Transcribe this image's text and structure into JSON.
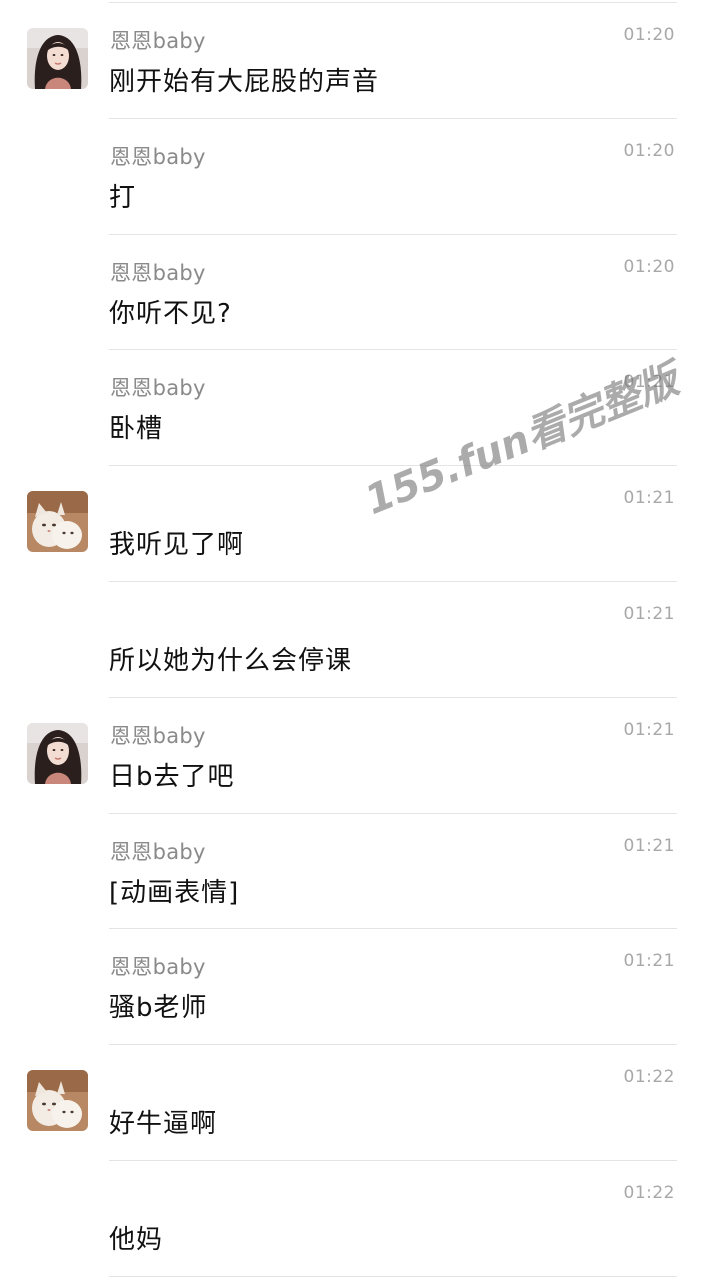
{
  "messages": [
    {
      "avatar": "girl-avatar",
      "sender": "恩恩baby",
      "time": "01:20",
      "text": "刚开始有大屁股的声音"
    },
    {
      "avatar": "",
      "sender": "恩恩baby",
      "time": "01:20",
      "text": "打"
    },
    {
      "avatar": "",
      "sender": "恩恩baby",
      "time": "01:20",
      "text": "你听不见?"
    },
    {
      "avatar": "",
      "sender": "恩恩baby",
      "time": "01:21",
      "text": "卧槽"
    },
    {
      "avatar": "cat-avatar",
      "sender": "",
      "time": "01:21",
      "text": "我听见了啊"
    },
    {
      "avatar": "",
      "sender": "",
      "time": "01:21",
      "text": "所以她为什么会停课"
    },
    {
      "avatar": "girl-avatar",
      "sender": "恩恩baby",
      "time": "01:21",
      "text": "日b去了吧"
    },
    {
      "avatar": "",
      "sender": "恩恩baby",
      "time": "01:21",
      "text": "[动画表情]"
    },
    {
      "avatar": "",
      "sender": "恩恩baby",
      "time": "01:21",
      "text": "骚b老师"
    },
    {
      "avatar": "cat-avatar",
      "sender": "",
      "time": "01:22",
      "text": "好牛逼啊"
    },
    {
      "avatar": "",
      "sender": "",
      "time": "01:22",
      "text": "他妈"
    }
  ],
  "watermark": "155.fun看完整版",
  "colors": {
    "divider": "#e4e4e4",
    "sender": "#8a8a8a",
    "time": "#a8a8a8",
    "text": "#111111"
  }
}
